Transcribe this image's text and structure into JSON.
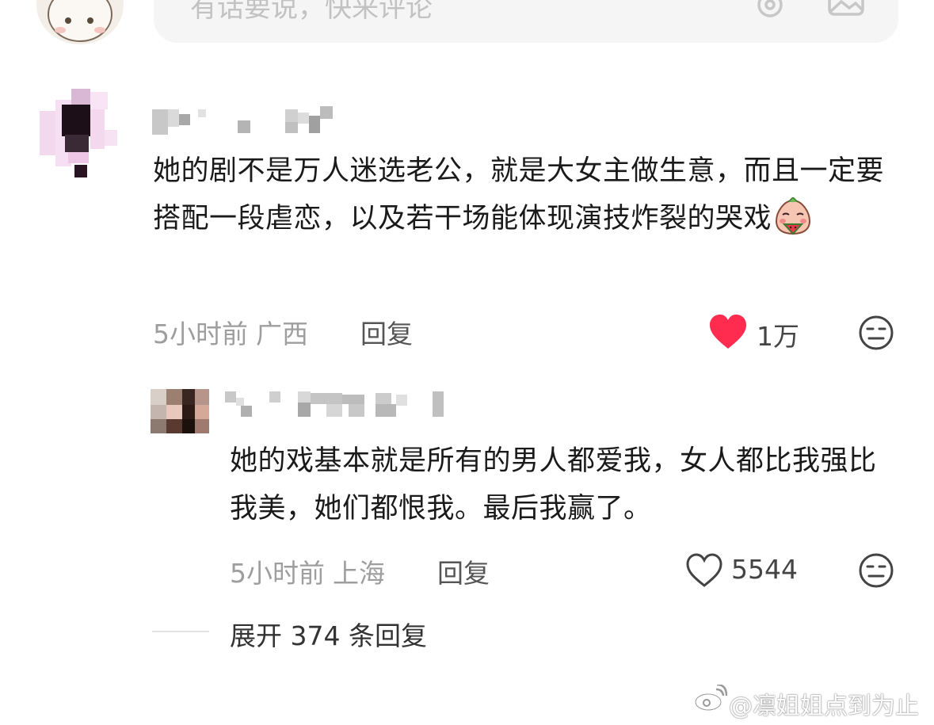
{
  "input_bar": {
    "placeholder": "有话要说，快来评论",
    "at_icon": "at-icon",
    "image_icon": "image-icon",
    "avatar": "cartoon-avatar"
  },
  "comment": {
    "text": "她的剧不是万人迷选老公，就是大女主做生意，而且一定要搭配一段虐恋，以及若干场能体现演技炸裂的哭戏",
    "emoji": "watermelon-face-emoji",
    "time": "5小时前",
    "location": "广西",
    "reply_label": "回复",
    "likes": "1万",
    "liked": true,
    "colors": {
      "heart": "#ff2c4f"
    }
  },
  "reply": {
    "text": "她的戏基本就是所有的男人都爱我，女人都比我强比我美，她们都恨我。最后我赢了。",
    "time": "5小时前",
    "location": "上海",
    "reply_label": "回复",
    "likes": "5544",
    "liked": false
  },
  "expand_replies": "展开 374 条回复",
  "watermark": "@凛姐姐点到为止"
}
